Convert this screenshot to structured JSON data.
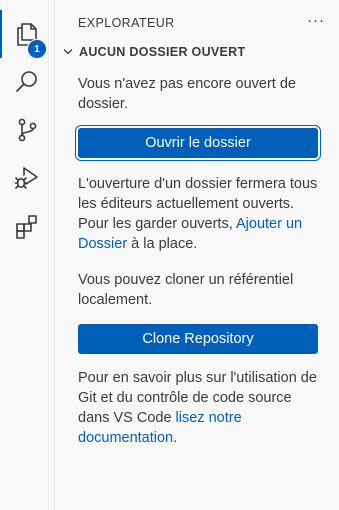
{
  "activity_bar": {
    "items": [
      {
        "name": "explorer",
        "icon": "files-icon",
        "active": true
      },
      {
        "name": "search",
        "icon": "search-icon",
        "active": false
      },
      {
        "name": "source-control",
        "icon": "source-control-icon",
        "active": false
      },
      {
        "name": "run-debug",
        "icon": "run-debug-icon",
        "active": false
      },
      {
        "name": "extensions",
        "icon": "extensions-icon",
        "active": false
      }
    ],
    "explorer_badge": "1"
  },
  "sidebar": {
    "title": "EXPLORATEUR",
    "more_label": "···",
    "section": {
      "title": "AUCUN DOSSIER OUVERT",
      "expanded": true
    },
    "intro_text": "Vous n'avez pas encore ouvert de dossier.",
    "open_folder_button": "Ouvrir le dossier",
    "warning_text_part1": "L'ouverture d'un dossier fermera tous les éditeurs actuellement ouverts. Pour les garder ouverts, ",
    "add_folder_link": "Ajouter un Dossier",
    "warning_text_part2": " à la place.",
    "clone_text": "Vous pouvez cloner un référentiel localement.",
    "clone_button": "Clone Repository",
    "learn_text_part1": "Pour en savoir plus sur l'utilisation de Git et du contrôle de code source dans VS Code ",
    "docs_link": "lisez notre documentation",
    "learn_text_part2": "."
  },
  "colors": {
    "accent": "#005fb8",
    "text": "#3b3b3b",
    "background": "#f8f8f8"
  }
}
